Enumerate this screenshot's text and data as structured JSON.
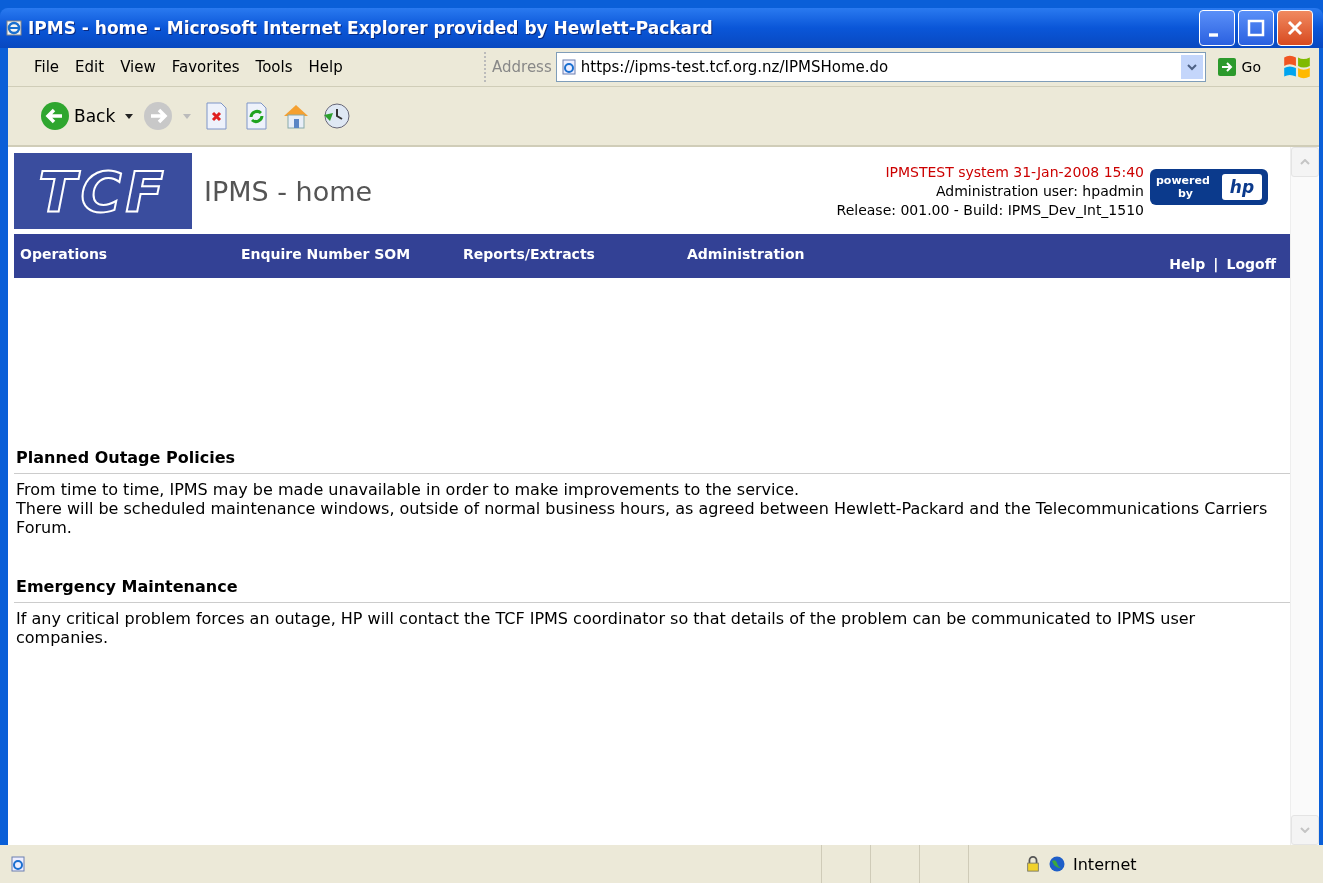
{
  "window": {
    "title": "IPMS - home - Microsoft Internet Explorer provided by Hewlett-Packard"
  },
  "menu": [
    "File",
    "Edit",
    "View",
    "Favorites",
    "Tools",
    "Help"
  ],
  "toolbar": {
    "back_label": "Back"
  },
  "address": {
    "label": "Address",
    "url": "https://ipms-test.tcf.org.nz/IPMSHome.do",
    "go_label": "Go"
  },
  "page": {
    "logo": "TCF",
    "title": "IPMS - home",
    "system_line": "IPMSTEST system 31-Jan-2008 15:40",
    "user_line": "Administration user: hpadmin",
    "release_line": "Release: 001.00 - Build: IPMS_Dev_Int_1510",
    "badge": {
      "text_top": "powered",
      "text_bottom": "by",
      "logo": "hp"
    },
    "nav": [
      "Operations",
      "Enquire Number SOM",
      "Reports/Extracts",
      "Administration"
    ],
    "nav_right": {
      "help": "Help",
      "separator": "|",
      "logoff": "Logoff"
    },
    "sections": [
      {
        "heading": "Planned Outage Policies",
        "paragraphs": [
          "From time to time, IPMS may be made unavailable in order to make improvements to the service.",
          "There will be scheduled maintenance windows, outside of normal business hours, as agreed between Hewlett-Packard and the Telecommunications Carriers Forum."
        ]
      },
      {
        "heading": "Emergency Maintenance",
        "paragraphs": [
          "If any critical problem forces an outage, HP will contact the TCF IPMS coordinator so that details of the problem can be communicated to IPMS user companies."
        ]
      }
    ]
  },
  "status_bar": {
    "zone": "Internet"
  }
}
